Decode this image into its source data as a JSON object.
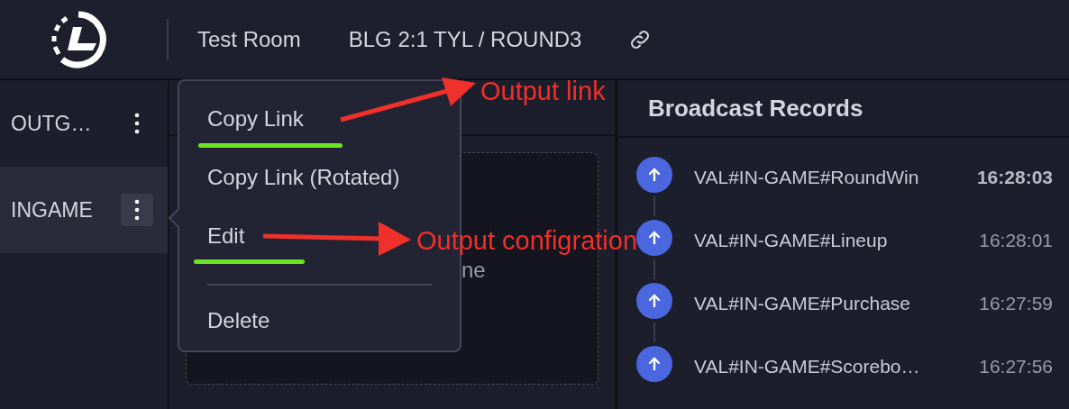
{
  "header": {
    "room": "Test Room",
    "match": "BLG 2:1 TYL / ROUND3"
  },
  "sidebar": {
    "items": [
      {
        "label": "OUTG…",
        "selected": false
      },
      {
        "label": "INGAME",
        "selected": true
      }
    ]
  },
  "context_menu": {
    "items": [
      {
        "label": "Copy Link",
        "divider_before": false
      },
      {
        "label": "Copy Link (Rotated)",
        "divider_before": false
      },
      {
        "label": "Edit",
        "divider_before": false
      },
      {
        "label": "Delete",
        "divider_before": true
      }
    ]
  },
  "preview": {
    "partial_text": "ne"
  },
  "records": {
    "title": "Broadcast Records",
    "items": [
      {
        "name": "VAL#IN-GAME#RoundWin",
        "time": "16:28:03",
        "latest": true
      },
      {
        "name": "VAL#IN-GAME#Lineup",
        "time": "16:28:01",
        "latest": false
      },
      {
        "name": "VAL#IN-GAME#Purchase",
        "time": "16:27:59",
        "latest": false
      },
      {
        "name": "VAL#IN-GAME#Scorebo…",
        "time": "16:27:56",
        "latest": false
      }
    ]
  },
  "annotations": [
    {
      "text": "Output link",
      "kind": "link"
    },
    {
      "text": "Output configration",
      "kind": "config"
    }
  ]
}
